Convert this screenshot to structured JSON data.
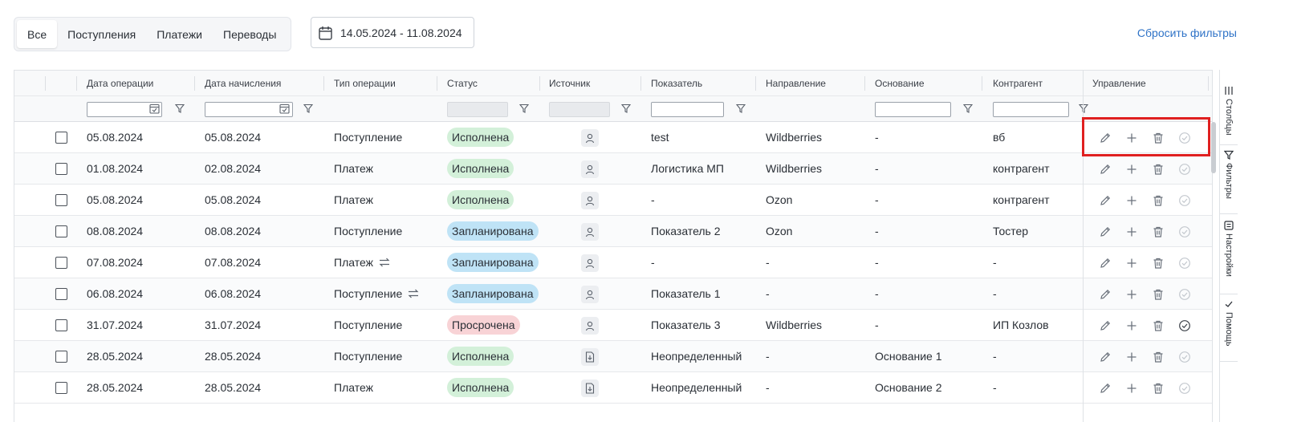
{
  "tabs": [
    {
      "label": "Все",
      "active": true
    },
    {
      "label": "Поступления",
      "active": false
    },
    {
      "label": "Платежи",
      "active": false
    },
    {
      "label": "Переводы",
      "active": false
    }
  ],
  "date_range": "14.05.2024 - 11.08.2024",
  "reset_label": "Сбросить фильтры",
  "columns": {
    "op_date": "Дата операции",
    "acc_date": "Дата начисления",
    "op_type": "Тип операции",
    "status": "Статус",
    "source": "Источник",
    "indicator": "Показатель",
    "direction": "Направление",
    "basis": "Основание",
    "counterparty": "Контрагент",
    "control": "Управление"
  },
  "rows": [
    {
      "op_date": "05.08.2024",
      "acc_date": "05.08.2024",
      "type": "Поступление",
      "transfer": false,
      "status": "Исполнена",
      "status_kind": "done",
      "source_icon": "person-icon",
      "indicator": "test",
      "direction": "Wildberries",
      "basis": "-",
      "counterparty": "вб",
      "confirm_active": false
    },
    {
      "op_date": "01.08.2024",
      "acc_date": "02.08.2024",
      "type": "Платеж",
      "transfer": false,
      "status": "Исполнена",
      "status_kind": "done",
      "source_icon": "person-icon",
      "indicator": "Логистика МП",
      "direction": "Wildberries",
      "basis": "-",
      "counterparty": "контрагент",
      "confirm_active": false
    },
    {
      "op_date": "05.08.2024",
      "acc_date": "05.08.2024",
      "type": "Платеж",
      "transfer": false,
      "status": "Исполнена",
      "status_kind": "done",
      "source_icon": "person-icon",
      "indicator": "-",
      "direction": "Ozon",
      "basis": "-",
      "counterparty": "контрагент",
      "confirm_active": false
    },
    {
      "op_date": "08.08.2024",
      "acc_date": "08.08.2024",
      "type": "Поступление",
      "transfer": false,
      "status": "Запланирована",
      "status_kind": "plan",
      "source_icon": "person-icon",
      "indicator": "Показатель 2",
      "direction": "Ozon",
      "basis": "-",
      "counterparty": "Тостер",
      "confirm_active": false
    },
    {
      "op_date": "07.08.2024",
      "acc_date": "07.08.2024",
      "type": "Платеж",
      "transfer": true,
      "status": "Запланирована",
      "status_kind": "plan",
      "source_icon": "person-icon",
      "indicator": "-",
      "direction": "-",
      "basis": "-",
      "counterparty": "-",
      "confirm_active": false
    },
    {
      "op_date": "06.08.2024",
      "acc_date": "06.08.2024",
      "type": "Поступление",
      "transfer": true,
      "status": "Запланирована",
      "status_kind": "plan",
      "source_icon": "person-icon",
      "indicator": "Показатель 1",
      "direction": "-",
      "basis": "-",
      "counterparty": "-",
      "confirm_active": false
    },
    {
      "op_date": "31.07.2024",
      "acc_date": "31.07.2024",
      "type": "Поступление",
      "transfer": false,
      "status": "Просрочена",
      "status_kind": "late",
      "source_icon": "person-icon",
      "indicator": "Показатель 3",
      "direction": "Wildberries",
      "basis": "-",
      "counterparty": "ИП Козлов",
      "confirm_active": true
    },
    {
      "op_date": "28.05.2024",
      "acc_date": "28.05.2024",
      "type": "Поступление",
      "transfer": false,
      "status": "Исполнена",
      "status_kind": "done",
      "source_icon": "file-import-icon",
      "indicator": "Неопределенный",
      "direction": "-",
      "basis": "Основание 1",
      "counterparty": "-",
      "confirm_active": false
    },
    {
      "op_date": "28.05.2024",
      "acc_date": "28.05.2024",
      "type": "Платеж",
      "transfer": false,
      "status": "Исполнена",
      "status_kind": "done",
      "source_icon": "file-import-icon",
      "indicator": "Неопределенный",
      "direction": "-",
      "basis": "Основание 2",
      "counterparty": "-",
      "confirm_active": false
    }
  ],
  "side_tabs": [
    {
      "label": "Столбцы",
      "icon": "columns-icon"
    },
    {
      "label": "Фильтры",
      "icon": "filter-icon"
    },
    {
      "label": "Настройки",
      "icon": "settings-icon"
    },
    {
      "label": "Помощь",
      "icon": "check-icon"
    }
  ],
  "colors": {
    "accent": "#2f73c7",
    "status_done": "#d3f0d9",
    "status_plan": "#bfe3f6",
    "status_late": "#f8d3d6",
    "highlight": "#e02020"
  }
}
